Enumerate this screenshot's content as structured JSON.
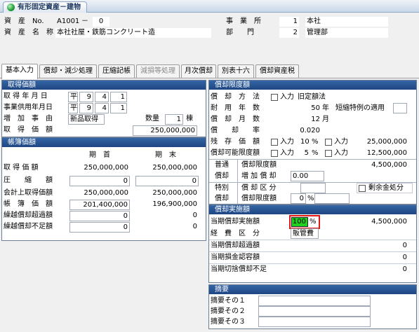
{
  "window": {
    "title": "有形固定資産－建物"
  },
  "header": {
    "asset_label": "資　産　No.",
    "asset_no": "A1001",
    "asset_dash": "－",
    "asset_sub": "0",
    "name_label": "資　産　名　称",
    "asset_name": "本社社屋・鉄筋コンクリート造",
    "office_label": "事　業　所",
    "office_code": "1",
    "office_name": "本社",
    "dept_label": "部　　門",
    "dept_code": "2",
    "dept_name": "管理部"
  },
  "tabs": [
    {
      "label": "基本入力",
      "state": "active"
    },
    {
      "label": "償却・減少処理",
      "state": "normal"
    },
    {
      "label": "圧縮記帳",
      "state": "normal"
    },
    {
      "label": "減損等処理",
      "state": "disabled"
    },
    {
      "label": "月次償却",
      "state": "normal"
    },
    {
      "label": "別表十六",
      "state": "normal"
    },
    {
      "label": "償却資産税",
      "state": "normal"
    }
  ],
  "acquisition": {
    "title": "取得価額",
    "acq_date_label": "取 得 年 月 日",
    "acq_era": "平",
    "acq_y": "9",
    "acq_m": "4",
    "acq_d": "1",
    "use_date_label": "事業供用年月日",
    "use_era": "平",
    "use_y": "9",
    "use_m": "4",
    "use_d": "1",
    "reason_label": "増　加　事　由",
    "reason": "新品取得",
    "qty_label": "数量",
    "qty": "1",
    "qty_unit": "棟",
    "cost_label": "取　得　価　額",
    "cost": "250,000,000"
  },
  "book": {
    "title": "帳簿価額",
    "col_begin": "期　首",
    "col_end": "期　末",
    "rows": [
      {
        "label": "取 得 価 額",
        "begin": "250,000,000",
        "end": "250,000,000"
      },
      {
        "label": "圧　　縮　　額",
        "begin": "0",
        "end": "0"
      },
      {
        "label": "会計上取得価額",
        "begin": "250,000,000",
        "end": "250,000,000"
      },
      {
        "label": "帳　簿　価　額",
        "begin": "201,400,000",
        "end": "196,900,000"
      },
      {
        "label": "繰越償却超過額",
        "begin": "0",
        "end": "0"
      },
      {
        "label": "繰越償却不足額",
        "begin": "0",
        "end": "0"
      }
    ]
  },
  "limit": {
    "title": "償却限度額",
    "method_label": "償　却　方　法",
    "input_label": "入力",
    "method": "旧定額法",
    "life_label": "耐　用　年　数",
    "life": "50",
    "life_unit": "年",
    "special_label": "短縮特例の適用",
    "months_label": "償　却　月　数",
    "months": "12",
    "months_unit": "月",
    "rate_label": "償　　却　　率",
    "rate": "0.020",
    "residual_label": "残　存　価　額",
    "residual_pct": "10",
    "pct_sign": "%",
    "residual": "25,000,000",
    "limitamt_label": "償却可能限度額",
    "limitamt_pct": "5",
    "limitamt": "12,500,000",
    "normal_label1": "普通",
    "normal_label2": "償却",
    "normal_limit_label": "償却限度額",
    "normal_limit": "4,500,000",
    "increase_label": "増 加 償 却",
    "increase": "0.00",
    "special_label1": "特別",
    "special_label2": "償却",
    "special_cls_label": "償 却 区 分",
    "surplus_label": "剰余金処分",
    "special_limit_label": "償却限度額",
    "special_pct": "0"
  },
  "actual": {
    "title": "償却実施額",
    "amount_label": "当期償却実施額",
    "amount_pct": "100",
    "amount": "4,500,000",
    "expense_label": "経　費　区　分",
    "expense": "販管費",
    "rows": [
      {
        "label": "当期償却超過額",
        "value": "0"
      },
      {
        "label": "当期損金認容額",
        "value": "0"
      },
      {
        "label": "当期切捨償却不足",
        "value": "0"
      }
    ]
  },
  "summary": {
    "title": "摘要",
    "rows": [
      {
        "label": "摘要その１"
      },
      {
        "label": "摘要その２"
      },
      {
        "label": "摘要その３"
      }
    ]
  }
}
